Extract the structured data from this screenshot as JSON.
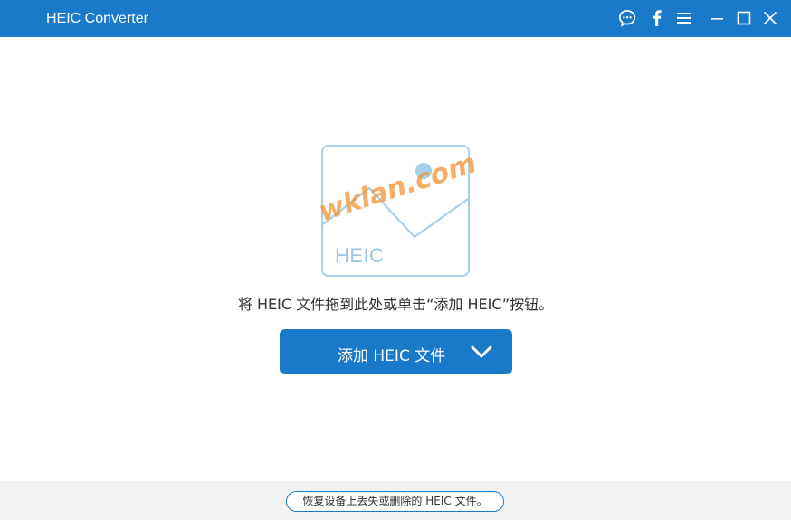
{
  "window": {
    "title": "HEIC Converter",
    "accent_color": "#1a7ac9",
    "controls": [
      "chat-icon",
      "facebook-icon",
      "menu-icon",
      "minimize-icon",
      "maximize-icon",
      "close-icon"
    ]
  },
  "main": {
    "placeholder_label": "HEIC",
    "watermark": "wklan.com",
    "hint": "将 HEIC 文件拖到此处或单击“添加 HEIC”按钮。",
    "add_button": {
      "label": "添加 HEIC 文件",
      "icon": "chevron-down-icon"
    }
  },
  "footer": {
    "recover_link": "恢复设备上丢失或删除的 HEIC 文件。"
  }
}
